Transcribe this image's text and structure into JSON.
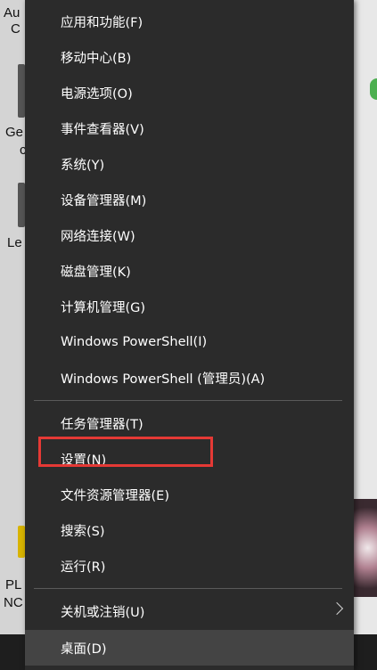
{
  "desktop": {
    "labels": [
      "Au",
      "C",
      "Ge",
      "c",
      "Le",
      "PL",
      "NC"
    ]
  },
  "menu": {
    "items": [
      {
        "label": "应用和功能(F)"
      },
      {
        "label": "移动中心(B)"
      },
      {
        "label": "电源选项(O)"
      },
      {
        "label": "事件查看器(V)"
      },
      {
        "label": "系统(Y)"
      },
      {
        "label": "设备管理器(M)"
      },
      {
        "label": "网络连接(W)"
      },
      {
        "label": "磁盘管理(K)"
      },
      {
        "label": "计算机管理(G)"
      },
      {
        "label": "Windows PowerShell(I)"
      },
      {
        "label": "Windows PowerShell (管理员)(A)"
      },
      {
        "label": "任务管理器(T)"
      },
      {
        "label": "设置(N)"
      },
      {
        "label": "文件资源管理器(E)"
      },
      {
        "label": "搜索(S)"
      },
      {
        "label": "运行(R)"
      },
      {
        "label": "关机或注销(U)"
      },
      {
        "label": "桌面(D)"
      }
    ]
  },
  "annotation": {
    "highlight_color": "#e53935"
  }
}
